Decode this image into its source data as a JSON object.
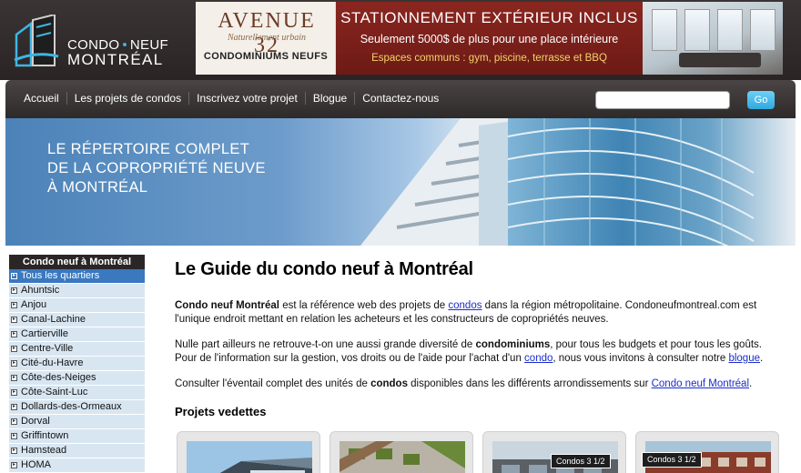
{
  "header": {
    "logo": {
      "line1_a": "CONDO",
      "line1_b": "NEUF",
      "line2": "MONTRÉAL"
    },
    "banner": {
      "brand": "AVENUE 32",
      "tagline": "Naturellement urbain",
      "brand_sub": "CONDOMINIUMS NEUFS",
      "promo_line1": "STATIONNEMENT EXTÉRIEUR INCLUS",
      "promo_line2": "Seulement 5000$ de plus pour une place intérieure",
      "promo_line3": "Espaces communs : gym, piscine, terrasse et BBQ"
    }
  },
  "nav": {
    "links": [
      "Accueil",
      "Les projets de condos",
      "Inscrivez votre projet",
      "Blogue",
      "Contactez-nous"
    ],
    "search_value": "",
    "search_button": "Go"
  },
  "hero": {
    "line1": "LE RÉPERTOIRE COMPLET",
    "line2": "DE LA COPROPRIÉTÉ NEUVE",
    "line3": "À MONTRÉAL"
  },
  "sidebar": {
    "title": "Condo neuf à Montréal",
    "items": [
      "Tous les quartiers",
      "Ahuntsic",
      "Anjou",
      "Canal-Lachine",
      "Cartierville",
      "Centre-Ville",
      "Cité-du-Havre",
      "Côte-des-Neiges",
      "Côte-Saint-Luc",
      "Dollards-des-Ormeaux",
      "Dorval",
      "Griffintown",
      "Hamstead",
      "HOMA"
    ],
    "active_index": 0
  },
  "main": {
    "title": "Le Guide du condo neuf à Montréal",
    "p1_strong": "Condo neuf Montréal",
    "p1_a": " est la référence web des projets de ",
    "p1_link": "condos",
    "p1_b": " dans la région métropolitaine. Condoneufmontreal.com est l'unique endroit mettant en relation les acheteurs et les constructeurs de copropriétés neuves.",
    "p2_a": "Nulle part ailleurs ne retrouve-t-on une aussi grande diversité de ",
    "p2_strong": "condominiums",
    "p2_b": ", pour tous les budgets et pour tous les goûts. Pour de l'information sur la gestion, vos droits ou de l'aide pour l'achat d'un ",
    "p2_link1": "condo",
    "p2_c": ", nous vous invitons à consulter notre ",
    "p2_link2": "blogue",
    "p2_d": ".",
    "p3_a": "Consulter l'éventail complet des unités de ",
    "p3_strong": "condos",
    "p3_b": " disponibles dans les différents arrondissements sur ",
    "p3_link": "Condo neuf Montréal",
    "p3_c": ".",
    "featured_title": "Projets vedettes"
  },
  "featured": {
    "card3_label": "Condos 3 1/2",
    "card4_label": "Condos 3 1/2"
  }
}
